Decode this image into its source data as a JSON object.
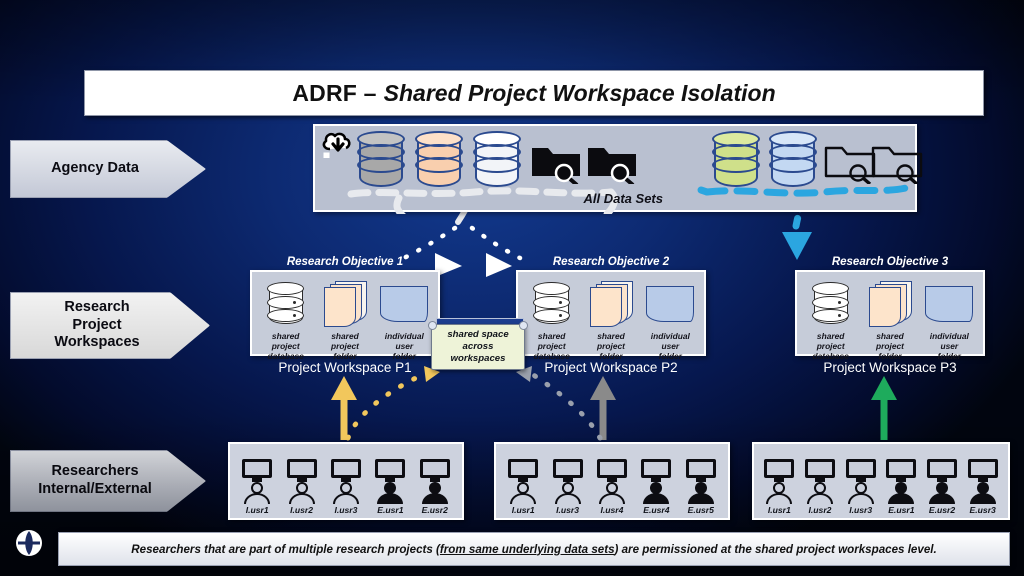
{
  "slide": {
    "title_primary": "ADRF –",
    "title_secondary": "Shared Project Workspace Isolation",
    "background_hex": "#0d2a72"
  },
  "stages": [
    {
      "id": "agency-data",
      "label": "Agency Data"
    },
    {
      "id": "research-project-workspaces",
      "label": "Research\nProject\nWorkspaces"
    },
    {
      "id": "researchers",
      "label": "Researchers\nInternal/External"
    }
  ],
  "agency_data": {
    "panel_label": "All Data Sets",
    "cloud_icon": "cloud-download-icon",
    "left_group": {
      "databases": [
        {
          "name": "database-gray",
          "color": "#a8a8a8"
        },
        {
          "name": "database-peach",
          "color": "#f9cfae"
        },
        {
          "name": "database-white",
          "color": "#f2f4f8"
        }
      ],
      "folders": [
        {
          "name": "folder-search-filled-1",
          "style": "filled"
        },
        {
          "name": "folder-search-filled-2",
          "style": "filled"
        }
      ]
    },
    "right_group": {
      "databases": [
        {
          "name": "database-green",
          "color": "#cfe08a"
        },
        {
          "name": "database-blue",
          "color": "#c3d8f2"
        }
      ],
      "folders": [
        {
          "name": "folder-search-outline-1",
          "style": "outline"
        },
        {
          "name": "folder-search-outline-2",
          "style": "outline"
        }
      ]
    },
    "dash_left_color": "#e8eaee",
    "dash_right_color": "#2ba6e0"
  },
  "shared_space": {
    "label": "shared space\nacross\nworkspaces",
    "fill_hex": "#eef3d8"
  },
  "workspace_item_captions": [
    {
      "name": "shared-project-database",
      "caption": "shared\nproject\ndatabase"
    },
    {
      "name": "shared-project-folder",
      "caption": "shared\nproject\nfolder"
    },
    {
      "name": "individual-user-folder",
      "caption": "individual\nuser\nfolder"
    }
  ],
  "workspaces": [
    {
      "id": "p1",
      "objective": "Research Objective 1",
      "caption": "Project Workspace P1",
      "arrow_color": "#f2c75c",
      "arrow_name": "arrow-up-yellow"
    },
    {
      "id": "p2",
      "objective": "Research Objective 2",
      "caption": "Project Workspace P2",
      "arrow_color": "#8a8a8a",
      "arrow_name": "arrow-up-gray"
    },
    {
      "id": "p3",
      "objective": "Research Objective 3",
      "caption": "Project Workspace P3",
      "arrow_color": "#1eab5c",
      "arrow_name": "arrow-up-green"
    }
  ],
  "researcher_groups": [
    {
      "id": "group-p1",
      "users": [
        {
          "name": "I.usr1",
          "type": "internal"
        },
        {
          "name": "I.usr2",
          "type": "internal"
        },
        {
          "name": "I.usr3",
          "type": "internal"
        },
        {
          "name": "E.usr1",
          "type": "external"
        },
        {
          "name": "E.usr2",
          "type": "external"
        }
      ]
    },
    {
      "id": "group-p2",
      "users": [
        {
          "name": "I.usr1",
          "type": "internal"
        },
        {
          "name": "I.usr3",
          "type": "internal"
        },
        {
          "name": "I.usr4",
          "type": "internal"
        },
        {
          "name": "E.usr4",
          "type": "external"
        },
        {
          "name": "E.usr5",
          "type": "external"
        }
      ]
    },
    {
      "id": "group-p3",
      "users": [
        {
          "name": "I.usr1",
          "type": "internal"
        },
        {
          "name": "I.usr2",
          "type": "internal"
        },
        {
          "name": "I.usr3",
          "type": "internal"
        },
        {
          "name": "E.usr1",
          "type": "external"
        },
        {
          "name": "E.usr2",
          "type": "external"
        },
        {
          "name": "E.usr3",
          "type": "external"
        }
      ]
    }
  ],
  "footer": {
    "text_before": "Researchers that are part of multiple research projects (",
    "text_underlined": "from same underlying data sets",
    "text_after": ") are permissioned at the shared project workspaces level.",
    "logo_name": "organization-logo"
  }
}
